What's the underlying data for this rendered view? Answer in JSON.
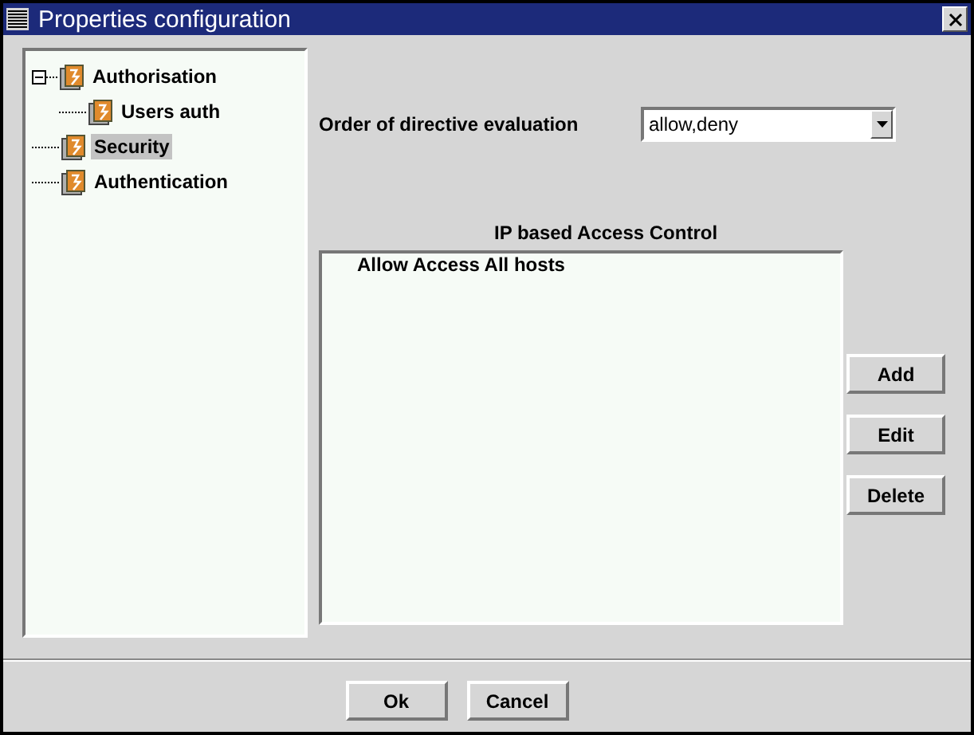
{
  "window": {
    "title": "Properties configuration"
  },
  "tree": [
    {
      "label": "Authorisation",
      "selected": false,
      "expanded": true,
      "children": [
        {
          "label": "Users auth",
          "selected": false
        }
      ]
    },
    {
      "label": "Security",
      "selected": true
    },
    {
      "label": "Authentication",
      "selected": false
    }
  ],
  "order": {
    "label": "Order of directive evaluation",
    "value": "allow,deny"
  },
  "access": {
    "heading": "IP based Access Control",
    "items": [
      "Allow Access All hosts"
    ],
    "buttons": [
      "Add",
      "Edit",
      "Delete"
    ]
  },
  "buttons": [
    "Ok",
    "Cancel"
  ]
}
